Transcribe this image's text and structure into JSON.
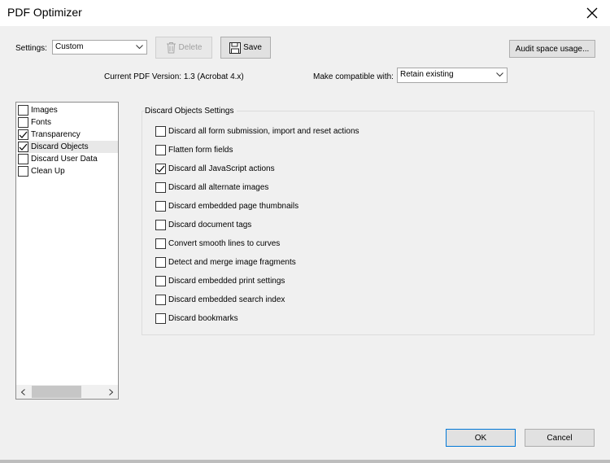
{
  "window": {
    "title": "PDF Optimizer"
  },
  "settings": {
    "label": "Settings:",
    "value": "Custom",
    "delete_label": "Delete",
    "save_label": "Save",
    "audit_label": "Audit space usage..."
  },
  "version": {
    "current_label": "Current PDF Version: 1.3 (Acrobat 4.x)",
    "compat_label": "Make compatible with:",
    "compat_value": "Retain existing"
  },
  "panels": [
    {
      "label": "Images",
      "checked": false,
      "selected": false
    },
    {
      "label": "Fonts",
      "checked": false,
      "selected": false
    },
    {
      "label": "Transparency",
      "checked": true,
      "selected": false
    },
    {
      "label": "Discard Objects",
      "checked": true,
      "selected": true
    },
    {
      "label": "Discard User Data",
      "checked": false,
      "selected": false
    },
    {
      "label": "Clean Up",
      "checked": false,
      "selected": false
    }
  ],
  "discard_objects": {
    "title": "Discard Objects Settings",
    "options": [
      {
        "label": "Discard all form submission, import and reset actions",
        "checked": false
      },
      {
        "label": "Flatten form fields",
        "checked": false
      },
      {
        "label": "Discard all JavaScript actions",
        "checked": true
      },
      {
        "label": "Discard all alternate images",
        "checked": false
      },
      {
        "label": "Discard embedded page thumbnails",
        "checked": false
      },
      {
        "label": "Discard document tags",
        "checked": false
      },
      {
        "label": "Convert smooth lines to curves",
        "checked": false
      },
      {
        "label": "Detect and merge image fragments",
        "checked": false
      },
      {
        "label": "Discard embedded print settings",
        "checked": false
      },
      {
        "label": "Discard embedded search index",
        "checked": false
      },
      {
        "label": "Discard bookmarks",
        "checked": false
      }
    ]
  },
  "footer": {
    "ok_label": "OK",
    "cancel_label": "Cancel"
  },
  "colors": {
    "default_button_border": "#0078d7",
    "window_bg": "#f0f0f0"
  }
}
